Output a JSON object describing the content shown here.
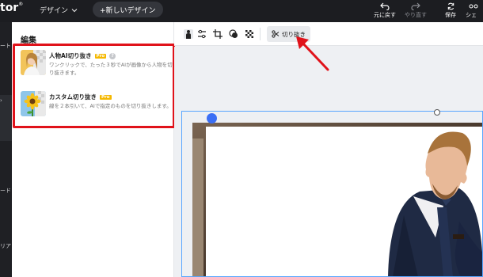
{
  "app": {
    "logo": "tor",
    "logo_mark": "®"
  },
  "topbar": {
    "design_menu": "デザイン",
    "new_design": "+新しいデザイン",
    "undo": "元に戻す",
    "redo": "やり直す",
    "save": "保存",
    "share": "シェ"
  },
  "left_rail": {
    "items": [
      "ート",
      "ード",
      "リア"
    ]
  },
  "panel": {
    "title": "編集",
    "tools": [
      {
        "name": "人物AI切り抜き",
        "badge": "Pro",
        "desc": "ワンクリックで、たった３秒でAIが画像から人物を切り抜きます。"
      },
      {
        "name": "カスタム切り抜き",
        "badge": "Pro",
        "desc": "線を２本引いて、AIで指定のものを切り抜きします。"
      }
    ]
  },
  "toolbar": {
    "cut_label": "切り抜き"
  },
  "colors": {
    "highlight": "#e0121a",
    "pro": "#f5b800",
    "selection": "#58a6ff"
  }
}
